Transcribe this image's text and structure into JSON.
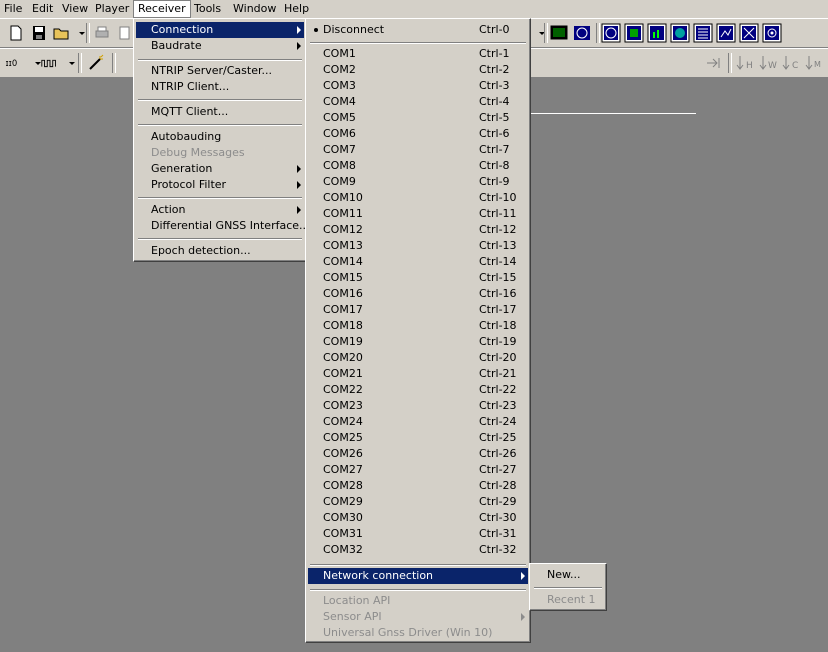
{
  "menubar": [
    "File",
    "Edit",
    "View",
    "Player",
    "Receiver",
    "Tools",
    "Window",
    "Help"
  ],
  "receiver_menu": {
    "items": [
      {
        "label": "Connection",
        "submenu": true
      },
      {
        "label": "Baudrate",
        "submenu": true
      },
      {
        "label": "NTRIP Server/Caster..."
      },
      {
        "label": "NTRIP Client..."
      },
      {
        "label": "MQTT Client..."
      },
      {
        "label": "Autobauding"
      },
      {
        "label": "Debug Messages",
        "disabled": true
      },
      {
        "label": "Generation",
        "submenu": true
      },
      {
        "label": "Protocol Filter",
        "submenu": true
      },
      {
        "label": "Action",
        "submenu": true
      },
      {
        "label": "Differential GNSS Interface..."
      },
      {
        "label": "Epoch detection..."
      }
    ]
  },
  "connection_menu": {
    "disconnect": {
      "label": "Disconnect",
      "shortcut": "Ctrl-0"
    },
    "ports": [
      {
        "label": "COM1",
        "shortcut": "Ctrl-1"
      },
      {
        "label": "COM2",
        "shortcut": "Ctrl-2"
      },
      {
        "label": "COM3",
        "shortcut": "Ctrl-3"
      },
      {
        "label": "COM4",
        "shortcut": "Ctrl-4"
      },
      {
        "label": "COM5",
        "shortcut": "Ctrl-5"
      },
      {
        "label": "COM6",
        "shortcut": "Ctrl-6"
      },
      {
        "label": "COM7",
        "shortcut": "Ctrl-7"
      },
      {
        "label": "COM8",
        "shortcut": "Ctrl-8"
      },
      {
        "label": "COM9",
        "shortcut": "Ctrl-9"
      },
      {
        "label": "COM10",
        "shortcut": "Ctrl-10"
      },
      {
        "label": "COM11",
        "shortcut": "Ctrl-11"
      },
      {
        "label": "COM12",
        "shortcut": "Ctrl-12"
      },
      {
        "label": "COM13",
        "shortcut": "Ctrl-13"
      },
      {
        "label": "COM14",
        "shortcut": "Ctrl-14"
      },
      {
        "label": "COM15",
        "shortcut": "Ctrl-15"
      },
      {
        "label": "COM16",
        "shortcut": "Ctrl-16"
      },
      {
        "label": "COM17",
        "shortcut": "Ctrl-17"
      },
      {
        "label": "COM18",
        "shortcut": "Ctrl-18"
      },
      {
        "label": "COM19",
        "shortcut": "Ctrl-19"
      },
      {
        "label": "COM20",
        "shortcut": "Ctrl-20"
      },
      {
        "label": "COM21",
        "shortcut": "Ctrl-21"
      },
      {
        "label": "COM22",
        "shortcut": "Ctrl-22"
      },
      {
        "label": "COM23",
        "shortcut": "Ctrl-23"
      },
      {
        "label": "COM24",
        "shortcut": "Ctrl-24"
      },
      {
        "label": "COM25",
        "shortcut": "Ctrl-25"
      },
      {
        "label": "COM26",
        "shortcut": "Ctrl-26"
      },
      {
        "label": "COM27",
        "shortcut": "Ctrl-27"
      },
      {
        "label": "COM28",
        "shortcut": "Ctrl-28"
      },
      {
        "label": "COM29",
        "shortcut": "Ctrl-29"
      },
      {
        "label": "COM30",
        "shortcut": "Ctrl-30"
      },
      {
        "label": "COM31",
        "shortcut": "Ctrl-31"
      },
      {
        "label": "COM32",
        "shortcut": "Ctrl-32"
      }
    ],
    "network": "Network connection",
    "location_api": "Location API",
    "sensor_api": "Sensor API",
    "universal_driver": "Universal Gnss Driver (Win 10)"
  },
  "network_menu": {
    "new": "New...",
    "recent": "Recent 1"
  },
  "toolbar2": {
    "interval_label": "ıI"
  },
  "colors": {
    "highlight": "#0a246a",
    "face": "#d4d0c8",
    "workspace": "#808080"
  }
}
